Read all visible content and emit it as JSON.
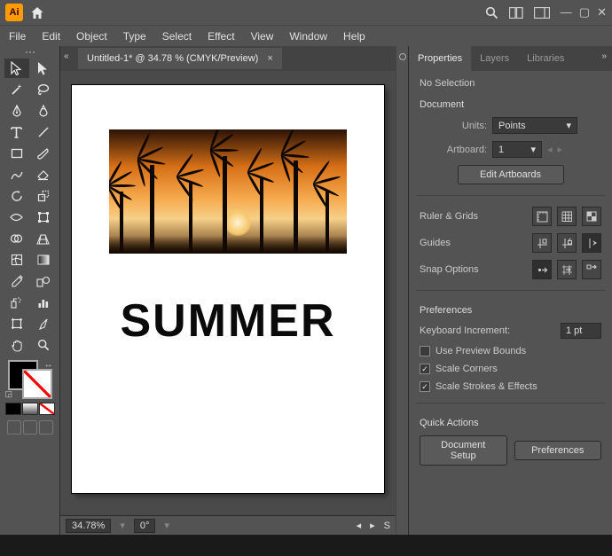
{
  "app": {
    "logo": "Ai"
  },
  "menu": [
    "File",
    "Edit",
    "Object",
    "Type",
    "Select",
    "Effect",
    "View",
    "Window",
    "Help"
  ],
  "doc_tab": {
    "title": "Untitled-1* @ 34.78 % (CMYK/Preview)",
    "close": "×"
  },
  "canvas": {
    "text": "SUMMER"
  },
  "statusbar": {
    "zoom": "34.78%",
    "rotate": "0°",
    "tip": "S"
  },
  "panel": {
    "tabs": [
      "Properties",
      "Layers",
      "Libraries"
    ],
    "active_tab": 0,
    "selection": "No Selection",
    "document_label": "Document",
    "units_label": "Units:",
    "units_value": "Points",
    "artboard_label": "Artboard:",
    "artboard_value": "1",
    "edit_artboards": "Edit Artboards",
    "ruler_label": "Ruler & Grids",
    "guides_label": "Guides",
    "snap_label": "Snap Options",
    "prefs_label": "Preferences",
    "kb_inc_label": "Keyboard Increment:",
    "kb_inc_value": "1 pt",
    "preview_bounds": "Use Preview Bounds",
    "scale_corners": "Scale Corners",
    "scale_strokes": "Scale Strokes & Effects",
    "quick_actions": "Quick Actions",
    "doc_setup": "Document Setup",
    "prefs_btn": "Preferences"
  }
}
